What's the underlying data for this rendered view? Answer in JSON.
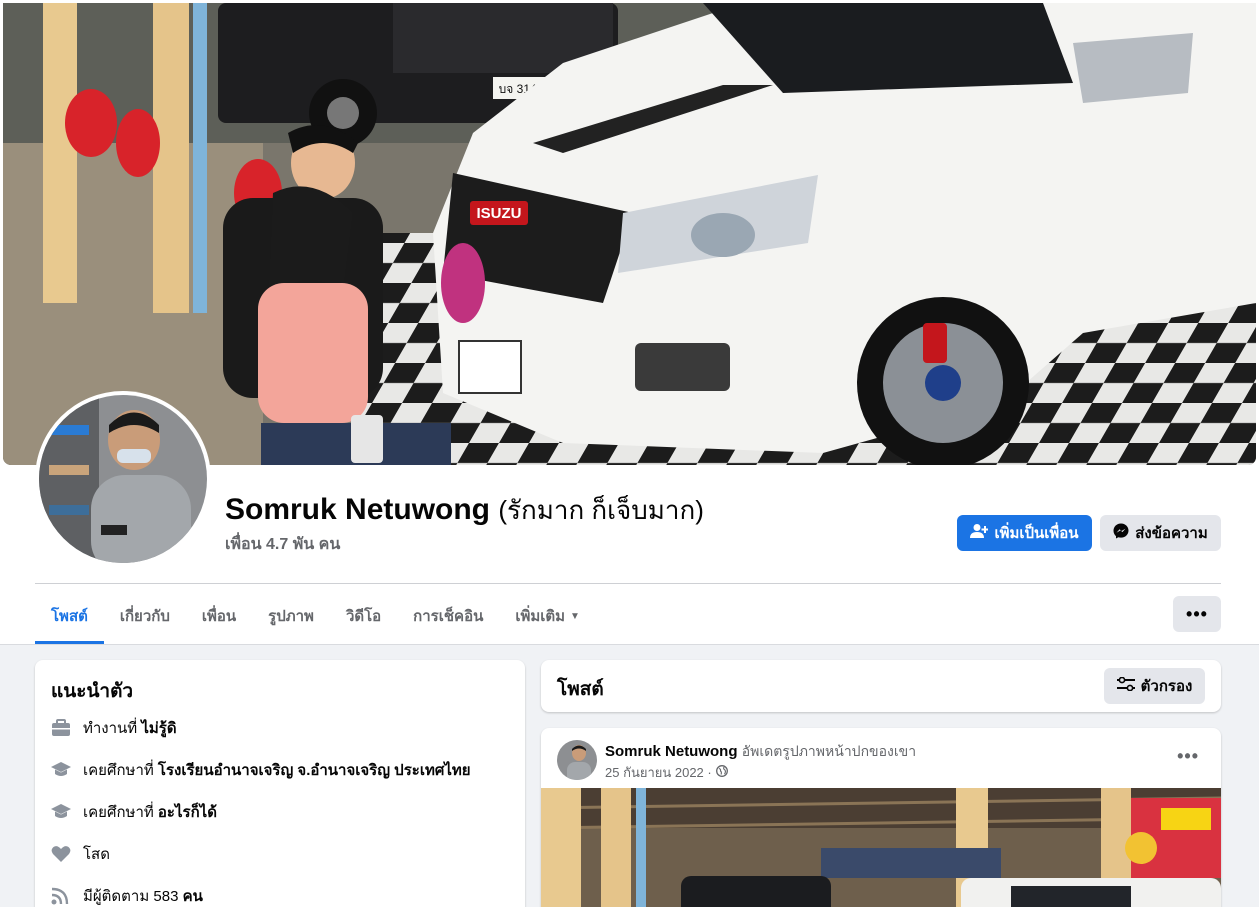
{
  "profile": {
    "name": "Somruk Netuwong",
    "alternate_name": "(รักมาก ก็เจ็บมาก)",
    "friends": "เพื่อน 4.7 พัน คน",
    "cover_plate_text": "บจ 3149",
    "cover_badge_text": "ISUZU"
  },
  "actions": {
    "add_friend_label": "เพิ่มเป็นเพื่อน",
    "message_label": "ส่งข้อความ",
    "more_label": "•••"
  },
  "tabs": [
    {
      "label": "โพสต์",
      "active": true
    },
    {
      "label": "เกี่ยวกับ"
    },
    {
      "label": "เพื่อน"
    },
    {
      "label": "รูปภาพ"
    },
    {
      "label": "วิดีโอ"
    },
    {
      "label": "การเช็คอิน"
    },
    {
      "label": "เพิ่มเติม"
    }
  ],
  "intro": {
    "title": "แนะนำตัว",
    "items": [
      {
        "icon": "briefcase-icon",
        "prefix": "ทำงานที่ ",
        "value": "ไม่รู้ดิ"
      },
      {
        "icon": "graduation-cap-icon",
        "prefix": "เคยศึกษาที่ ",
        "value": "โรงเรียนอำนาจเจริญ จ.อำนาจเจริญ ประเทศไทย"
      },
      {
        "icon": "graduation-cap-icon",
        "prefix": "เคยศึกษาที่ ",
        "value": "อะไรก็ได้"
      },
      {
        "icon": "heart-icon",
        "prefix": "",
        "value": "โสด"
      },
      {
        "icon": "rss-icon",
        "prefix": "มีผู้ติดตาม 583 ",
        "value": "คน"
      }
    ]
  },
  "posts": {
    "title": "โพสต์",
    "filter_label": "ตัวกรอง",
    "first": {
      "author": "Somruk Netuwong",
      "action": "อัพเดตรูปภาพหน้าปกของเขา",
      "date": "25 กันยายน 2022 ·"
    }
  },
  "colors": {
    "accent": "#1b74e4",
    "background": "#f0f2f5",
    "secondary_button": "#e4e6eb",
    "muted_text": "#65676b"
  }
}
